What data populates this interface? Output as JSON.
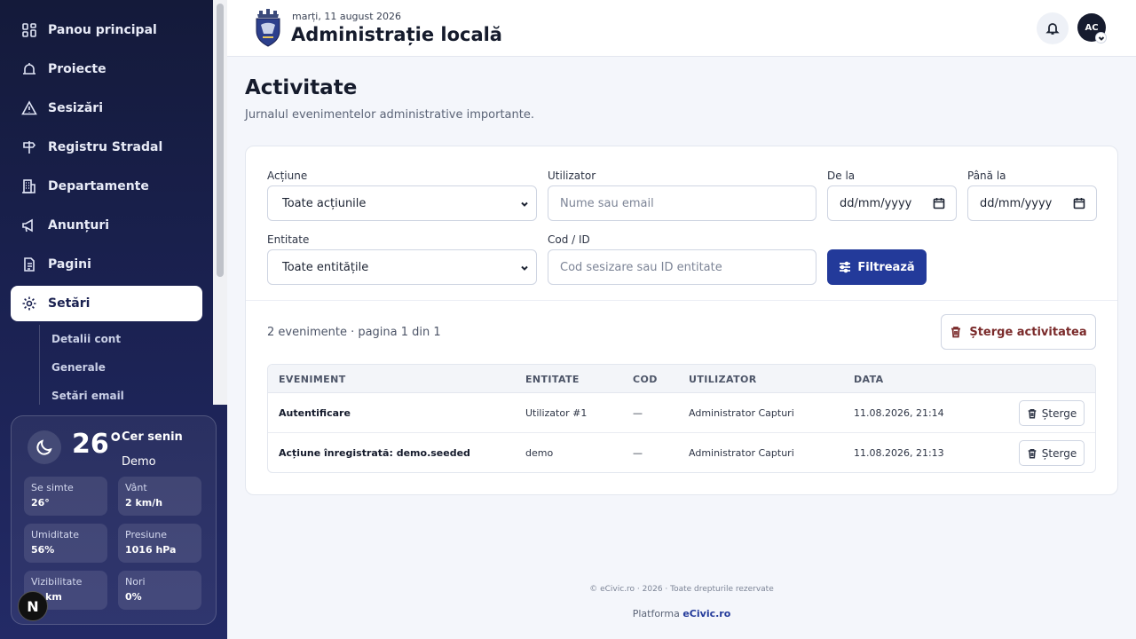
{
  "sidebar": {
    "items": [
      {
        "label": "Panou principal",
        "icon": "dashboard-icon"
      },
      {
        "label": "Proiecte",
        "icon": "projects-icon"
      },
      {
        "label": "Sesizări",
        "icon": "warning-icon"
      },
      {
        "label": "Registru Stradal",
        "icon": "signpost-icon"
      },
      {
        "label": "Departamente",
        "icon": "building-icon"
      },
      {
        "label": "Anunțuri",
        "icon": "megaphone-icon"
      },
      {
        "label": "Pagini",
        "icon": "page-icon"
      },
      {
        "label": "Setări",
        "icon": "gear-icon",
        "active": true
      }
    ],
    "subitems": [
      "Detalii cont",
      "Generale",
      "Setări email"
    ]
  },
  "weather": {
    "temp": "26°",
    "condition": "Cer senin",
    "tag": "Demo",
    "stats": [
      {
        "label": "Se simte",
        "value": "26°"
      },
      {
        "label": "Vânt",
        "value": "2 km/h"
      },
      {
        "label": "Umiditate",
        "value": "56%"
      },
      {
        "label": "Presiune",
        "value": "1016 hPa"
      },
      {
        "label": "Vizibilitate",
        "value": "km"
      },
      {
        "label": "Nori",
        "value": "0%"
      }
    ]
  },
  "badge_letter": "N",
  "header": {
    "date": "marți, 11 august 2026",
    "title": "Administrație locală",
    "avatar_initials": "AC"
  },
  "page": {
    "title": "Activitate",
    "subtitle": "Jurnalul evenimentelor administrative importante."
  },
  "filters": {
    "action_label": "Acțiune",
    "action_value": "Toate acțiunile",
    "user_label": "Utilizator",
    "user_placeholder": "Nume sau email",
    "from_label": "De la",
    "from_placeholder": "dd/mm/yyyy",
    "to_label": "Până la",
    "to_placeholder": "dd/mm/yyyy",
    "entity_label": "Entitate",
    "entity_value": "Toate entitățile",
    "code_label": "Cod / ID",
    "code_placeholder": "Cod sesizare sau ID entitate",
    "filter_button": "Filtrează"
  },
  "results": {
    "count_text": "2 evenimente · pagina 1 din 1",
    "clear_button": "Șterge activitatea"
  },
  "table": {
    "headers": [
      "EVENIMENT",
      "ENTITATE",
      "COD",
      "UTILIZATOR",
      "DATA"
    ],
    "rows": [
      {
        "event": "Autentificare",
        "entity": "Utilizator #1",
        "code": "—",
        "user": "Administrator Capturi",
        "date": "11.08.2026, 21:14",
        "action": "Șterge"
      },
      {
        "event": "Acțiune înregistrată: demo.seeded",
        "entity": "demo",
        "code": "—",
        "user": "Administrator Capturi",
        "date": "11.08.2026, 21:13",
        "action": "Șterge"
      }
    ]
  },
  "footer": {
    "copyright": "© eCivic.ro · 2026 · Toate drepturile rezervate",
    "platform_prefix": "Platforma",
    "platform_name": "eCivic.ro"
  },
  "colors": {
    "sidebar_bg": "#1a2150",
    "accent": "#233a9a",
    "danger_text": "#7a2a2a"
  }
}
